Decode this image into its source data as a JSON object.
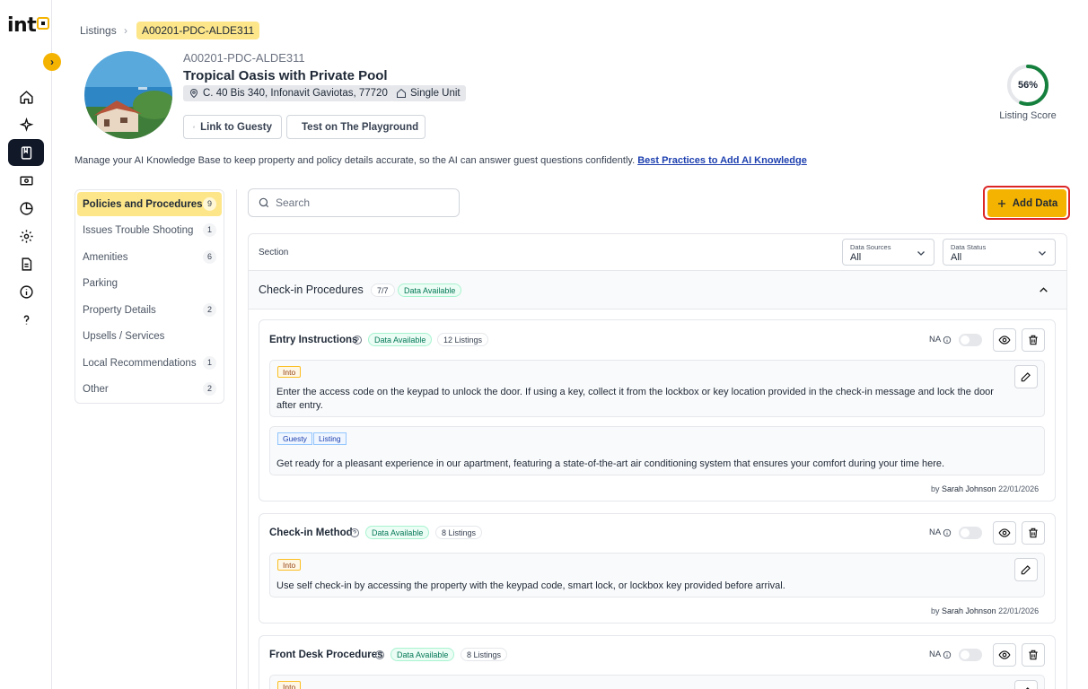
{
  "app": {
    "logo_text": "int",
    "accent": "#f5b301"
  },
  "rail": {
    "expand_icon": "chevron-right-icon",
    "icons": [
      "home-icon",
      "sparkle-icon",
      "book-icon",
      "money-icon",
      "chart-icon",
      "gear-icon",
      "document-icon",
      "info-icon",
      "help-icon"
    ],
    "active_icon": "book-icon"
  },
  "breadcrumb": {
    "root": "Listings",
    "current": "A00201-PDC-ALDE311"
  },
  "listing": {
    "code": "A00201-PDC-ALDE311",
    "name": "Tropical Oasis with Private Pool",
    "address": "C. 40 Bis 340, Infonavit Gaviotas, 77720",
    "unit_type": "Single Unit",
    "link_button": "Link to Guesty",
    "test_button": "Test on The Playground",
    "score_percent": 56,
    "score_text": "56%",
    "score_label": "Listing Score"
  },
  "intro": {
    "text": "Manage your AI Knowledge Base to keep property and policy details accurate, so the AI can answer guest questions confidently.",
    "link": "Best Practices to Add AI Knowledge"
  },
  "categories": [
    {
      "label": "Policies and Procedures",
      "count": "9",
      "active": true
    },
    {
      "label": "Issues Trouble Shooting",
      "count": "1"
    },
    {
      "label": "Amenities",
      "count": "6"
    },
    {
      "label": "Parking",
      "count": ""
    },
    {
      "label": "Property Details",
      "count": "2"
    },
    {
      "label": "Upsells / Services",
      "count": ""
    },
    {
      "label": "Local Recommendations",
      "count": "1"
    },
    {
      "label": "Other",
      "count": "2"
    }
  ],
  "search": {
    "placeholder": "Search"
  },
  "add_button": "Add Data",
  "table": {
    "section_header": "Section",
    "filters": [
      {
        "label": "Data Sources",
        "value": "All"
      },
      {
        "label": "Data Status",
        "value": "All"
      }
    ]
  },
  "section": {
    "title": "Check-in Procedures",
    "progress": "7/7",
    "status": "Data Available"
  },
  "items": [
    {
      "title": "Entry Instructions",
      "status": "Data Available",
      "listings": "12 Listings",
      "na": "NA",
      "entries": [
        {
          "tags": [
            "Into"
          ],
          "text": "Enter the access code on the keypad to unlock the door. If using a key, collect it from the lockbox or key location provided in the check-in message and lock the door after entry."
        },
        {
          "tags": [
            "Guesty",
            "Listing"
          ],
          "text": "Get ready for a pleasant experience in our apartment, featuring a state-of-the-art air conditioning system that ensures your comfort during your time here."
        }
      ],
      "by": "by",
      "author": "Sarah Johnson",
      "date": "22/01/2026"
    },
    {
      "title": "Check-in Method",
      "status": "Data Available",
      "listings": "8 Listings",
      "na": "NA",
      "entries": [
        {
          "tags": [
            "Into"
          ],
          "text": "Use self check-in by accessing the property with the keypad code, smart lock, or lockbox key provided before arrival."
        }
      ],
      "by": "by",
      "author": "Sarah Johnson",
      "date": "22/01/2026"
    },
    {
      "title": "Front Desk Procedures",
      "status": "Data Available",
      "listings": "8 Listings",
      "na": "NA",
      "entries": [
        {
          "tags": [
            "Into"
          ],
          "text": ""
        }
      ]
    }
  ]
}
